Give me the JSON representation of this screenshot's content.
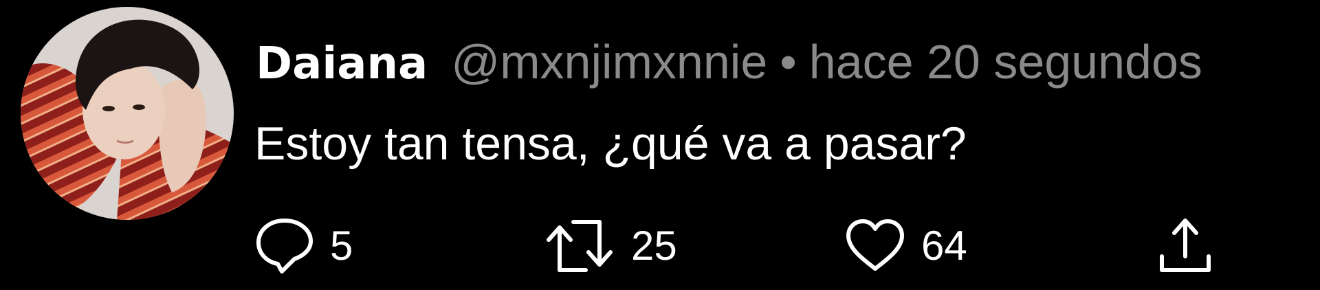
{
  "tweet": {
    "author": {
      "display_name": "Daiana",
      "handle": "@mxnjimxnnie",
      "avatar_icon": "user-avatar-photo"
    },
    "separator": "•",
    "timestamp": "hace 20 segundos",
    "text": "Estoy tan tensa, ¿qué va a pasar?",
    "actions": {
      "reply": {
        "icon": "reply-icon",
        "count": "5"
      },
      "retweet": {
        "icon": "retweet-icon",
        "count": "25"
      },
      "like": {
        "icon": "heart-icon",
        "count": "64"
      },
      "share": {
        "icon": "share-icon"
      }
    }
  },
  "colors": {
    "background": "#000000",
    "primary_text": "#ffffff",
    "secondary_text": "#8a8a8a"
  }
}
